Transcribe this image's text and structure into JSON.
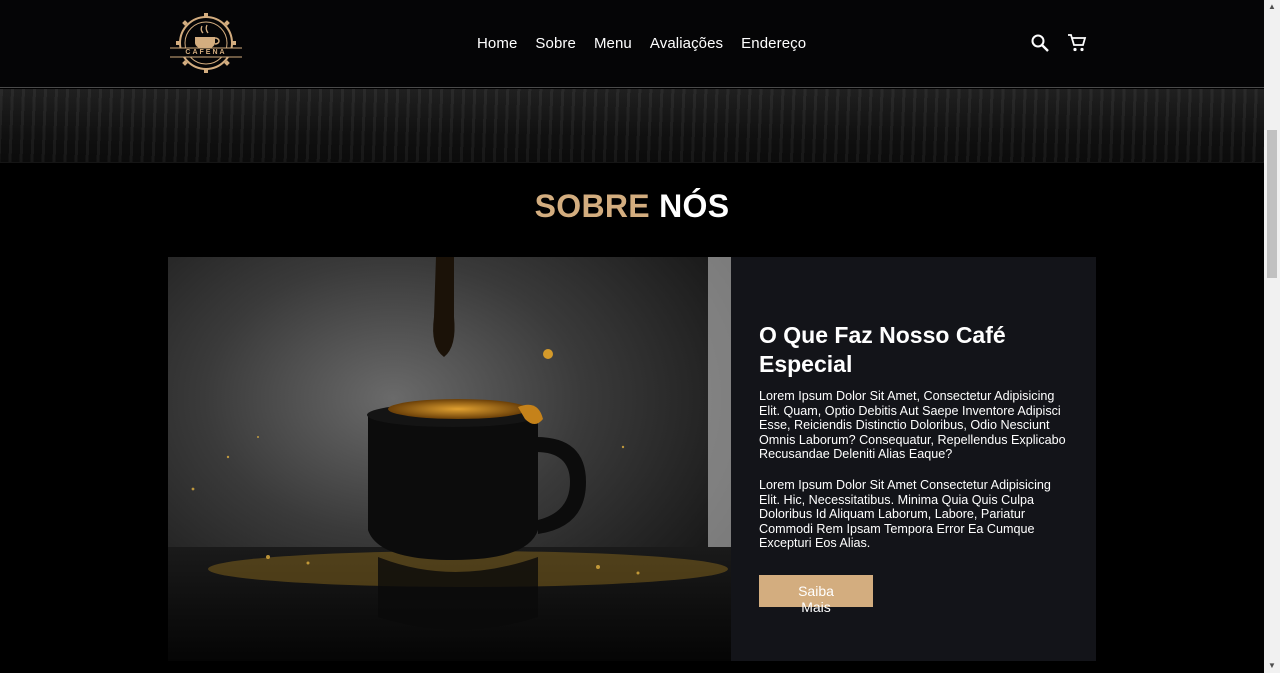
{
  "header": {
    "logo_text": "CAFENA",
    "nav": [
      "Home",
      "Sobre",
      "Menu",
      "Avaliações",
      "Endereço"
    ],
    "icons": [
      "search-icon",
      "cart-icon"
    ]
  },
  "about": {
    "title_accent": "SOBRE",
    "title_rest": "NÓS",
    "heading": "O Que Faz Nosso Café Especial",
    "paragraph1": "Lorem Ipsum Dolor Sit Amet, Consectetur Adipisicing Elit. Quam, Optio Debitis Aut Saepe Inventore Adipisci Esse, Reiciendis Distinctio Doloribus, Odio Nesciunt Omnis Laborum? Consequatur, Repellendus Explicabo Recusandae Deleniti Alias Eaque?",
    "paragraph2": "Lorem Ipsum Dolor Sit Amet Consectetur Adipisicing Elit. Hic, Necessitatibus. Minima Quia Quis Culpa Doloribus Id Aliquam Laborum, Labore, Pariatur Commodi Rem Ipsam Tempora Error Ea Cumque Excepturi Eos Alias.",
    "button_label": "Saiba Mais"
  },
  "colors": {
    "accent": "#d3ad7f",
    "panel": "#131419",
    "background": "#000000"
  }
}
